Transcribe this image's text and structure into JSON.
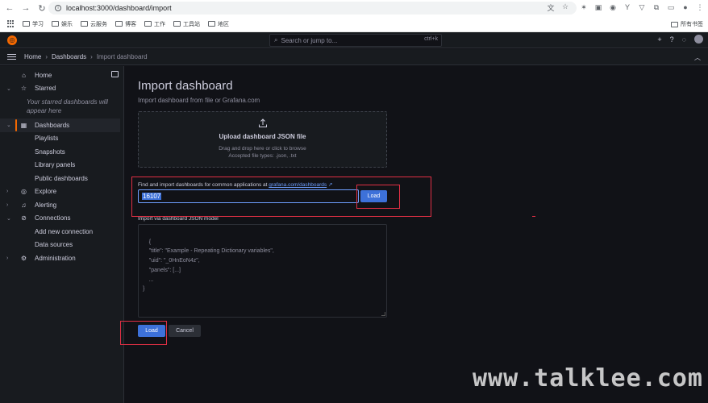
{
  "browser": {
    "url": "localhost:3000/dashboard/import",
    "bookmarks": [
      "学习",
      "娱乐",
      "云服务",
      "博客",
      "工作",
      "工具站",
      "地区"
    ],
    "bookmarks_right": "所有书签"
  },
  "topbar": {
    "search_placeholder": "Search or jump to...",
    "search_shortcut": "ctrl+k",
    "plus": "+"
  },
  "breadcrumb": {
    "home": "Home",
    "dashboards": "Dashboards",
    "current": "Import dashboard"
  },
  "sidebar": {
    "home": "Home",
    "starred": "Starred",
    "starred_empty": "Your starred dashboards will appear here",
    "dashboards": "Dashboards",
    "dashboards_sub": [
      "Playlists",
      "Snapshots",
      "Library panels",
      "Public dashboards"
    ],
    "explore": "Explore",
    "alerting": "Alerting",
    "connections": "Connections",
    "connections_sub": [
      "Add new connection",
      "Data sources"
    ],
    "administration": "Administration"
  },
  "main": {
    "title": "Import dashboard",
    "subtitle": "Import dashboard from file or Grafana.com",
    "upload": {
      "title": "Upload dashboard JSON file",
      "hint": "Drag and drop here or click to browse",
      "types": "Accepted file types: .json, .txt"
    },
    "find_label_prefix": "Find and import dashboards for common applications at ",
    "find_link": "grafana.com/dashboards",
    "id_value": "16107",
    "load_small": "Load",
    "json_label": "Import via dashboard JSON model",
    "json_placeholder": "{\n    \"title\": \"Example - Repeating Dictionary variables\",\n    \"uid\": \"_0HnEoN4z\",\n    \"panels\": [...]\n    ...\n}",
    "load": "Load",
    "cancel": "Cancel"
  },
  "watermark": "www.talklee.com"
}
